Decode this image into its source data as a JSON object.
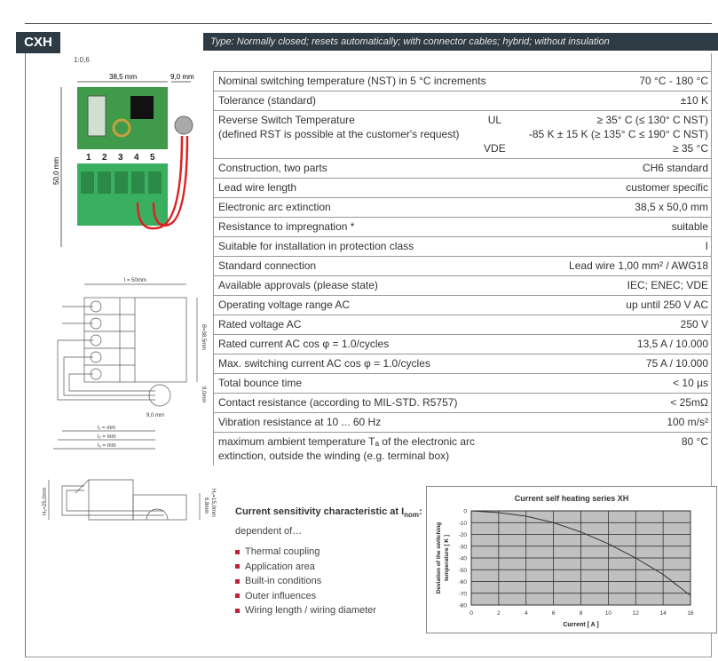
{
  "header": {
    "badge": "CXH",
    "type_line": "Type: Normally closed; resets automatically; with connector cables; hybrid; without insulation",
    "scale": "1:0,6"
  },
  "drawing": {
    "dim_width": "38,5 mm",
    "dim_probe": "9,0 mm",
    "dim_height": "50,0 mm",
    "terminals": [
      "1",
      "2",
      "3",
      "4",
      "5"
    ],
    "tech_l": "l = 50mm",
    "tech_b": "B=38,5mm",
    "tech_9a": "9,0mm",
    "tech_9b": "9,0 mm",
    "tech_l1": "l₁ =   mm",
    "tech_l2": "l₂ =   mm",
    "tech_l3": "l₃ =   mm",
    "tech_h1": "H₁=25,0mm",
    "tech_h2": "H₂=15,0mm",
    "tech_h3": "6,8mm"
  },
  "specs": [
    {
      "label": "Nominal switching temperature (NST) in 5 °C increments",
      "value": "70 °C - 180 °C"
    },
    {
      "label": "Tolerance (standard)",
      "value": "±10 K"
    },
    {
      "label": "Reverse Switch Temperature",
      "label2": "(defined RST is possible at the customer's request)",
      "mid1": "UL",
      "mid3": "VDE",
      "value": "≥ 35° C (≤ 130° C NST)",
      "value2": "-85 K ± 15 K (≥ 135° C ≤ 190° C NST)",
      "value3": "≥ 35 °C"
    },
    {
      "label": "Construction, two parts",
      "value": "CH6 standard"
    },
    {
      "label": "Lead wire length",
      "value": "customer specific"
    },
    {
      "label": "Electronic arc extinction",
      "value": "38,5 x 50,0 mm"
    },
    {
      "label": "Resistance to impregnation *",
      "value": "suitable"
    },
    {
      "label": "Suitable for installation in protection class",
      "value": "I"
    },
    {
      "label": "Standard connection",
      "value": "Lead wire 1,00 mm² / AWG18"
    },
    {
      "label": "Available approvals (please state)",
      "value": "IEC; ENEC; VDE"
    },
    {
      "label": "Operating voltage range AC",
      "value": "up until 250 V AC"
    },
    {
      "label": "Rated voltage AC",
      "value": "250 V"
    },
    {
      "label": "Rated current AC cos φ = 1.0/cycles",
      "value": "13,5 A / 10.000"
    },
    {
      "label": "Max. switching current AC cos φ = 1.0/cycles",
      "value": "75 A / 10.000"
    },
    {
      "label": "Total bounce time",
      "value": "< 10 µs"
    },
    {
      "label": "Contact resistance (according to MIL-STD. R5757)",
      "value": "< 25mΩ"
    },
    {
      "label": "Vibration resistance at 10 ... 60 Hz",
      "value": "100 m/s²"
    },
    {
      "label": "maximum ambient temperature Tₐ of the electronic arc",
      "label2": "extinction, outside the winding (e.g. terminal box)",
      "value": "80 °C"
    }
  ],
  "sensitivity": {
    "title": "Current sensitivity characteristic at I",
    "title_sub": "nom",
    "title_end": ":",
    "dependent": "dependent of…",
    "items": [
      "Thermal coupling",
      "Application area",
      "Built-in conditions",
      "Outer influences",
      "Wiring length / wiring diameter"
    ],
    "bullet_color": "#c0203a"
  },
  "chart_data": {
    "type": "line",
    "title": "Current self heating series XH",
    "xlabel": "Current [ A ]",
    "ylabel": "Deviation of the switching temperature [ K ]",
    "xlim": [
      0,
      16
    ],
    "ylim": [
      -80,
      0
    ],
    "xticks": [
      0,
      2,
      4,
      6,
      8,
      10,
      12,
      14,
      16
    ],
    "yticks": [
      0,
      -10,
      -20,
      -30,
      -40,
      -50,
      -60,
      -70,
      -80
    ],
    "grid": true,
    "plot_bg": "#c0c0c0",
    "x": [
      0,
      2,
      4,
      6,
      8,
      10,
      12,
      14,
      16
    ],
    "y": [
      0,
      -1.5,
      -4.5,
      -10,
      -18,
      -28,
      -40,
      -54,
      -72
    ]
  }
}
